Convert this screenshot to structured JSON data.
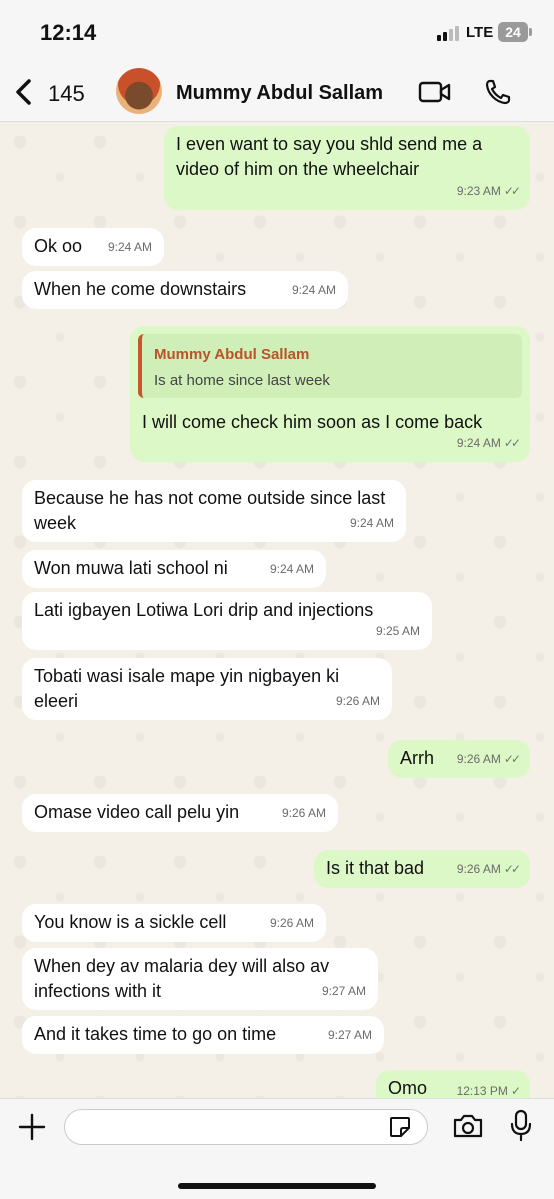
{
  "status_bar": {
    "time": "12:14",
    "network": "LTE",
    "battery": "24"
  },
  "header": {
    "back_count": "145",
    "contact_name": "Mummy Abdul Sallam",
    "icons": {
      "back": "chevron-left-icon",
      "video": "video-camera-icon",
      "call": "phone-icon"
    }
  },
  "messages": [
    {
      "dir": "out",
      "text": "I even want to say you shld send me a video of him on the wheelchair",
      "time": "9:23 AM",
      "read": true
    },
    {
      "dir": "in",
      "text": "Ok oo",
      "time": "9:24 AM"
    },
    {
      "dir": "in",
      "text": "When he come downstairs",
      "time": "9:24 AM"
    },
    {
      "dir": "out",
      "quote": {
        "name": "Mummy Abdul Sallam",
        "text": "Is at home since last week"
      },
      "text": "I will come check him soon as I come back",
      "time": "9:24 AM",
      "read": true
    },
    {
      "dir": "in",
      "text": "Because he has not come outside since last week",
      "time": "9:24 AM"
    },
    {
      "dir": "in",
      "text": "Won muwa lati school ni",
      "time": "9:24 AM"
    },
    {
      "dir": "in",
      "text": "Lati igbayen Lotiwa Lori drip and injections",
      "time": "9:25 AM"
    },
    {
      "dir": "in",
      "text": "Tobati wasi isale mape yin nigbayen ki eleeri",
      "time": "9:26 AM"
    },
    {
      "dir": "out",
      "text": "Arrh",
      "time": "9:26 AM",
      "read": true
    },
    {
      "dir": "in",
      "text": "Omase video call pelu yin",
      "time": "9:26 AM"
    },
    {
      "dir": "out",
      "text": "Is it that bad",
      "time": "9:26 AM",
      "read": true
    },
    {
      "dir": "in",
      "text": "You know is a sickle cell",
      "time": "9:26 AM"
    },
    {
      "dir": "in",
      "text": "When dey av malaria dey will also av infections with it",
      "time": "9:27 AM"
    },
    {
      "dir": "in",
      "text": "And it takes time to go on time",
      "time": "9:27 AM"
    },
    {
      "dir": "out",
      "text": "Omo",
      "time": "12:13 PM",
      "read": false
    }
  ],
  "input_bar": {
    "placeholder": "",
    "icons": {
      "add": "plus-icon",
      "sticker": "sticker-icon",
      "camera": "camera-icon",
      "mic": "microphone-icon"
    }
  },
  "colors": {
    "incoming": "#ffffff",
    "outgoing": "#dcf8c6",
    "quote_accent": "#c4572e",
    "background": "#f4efe7"
  }
}
